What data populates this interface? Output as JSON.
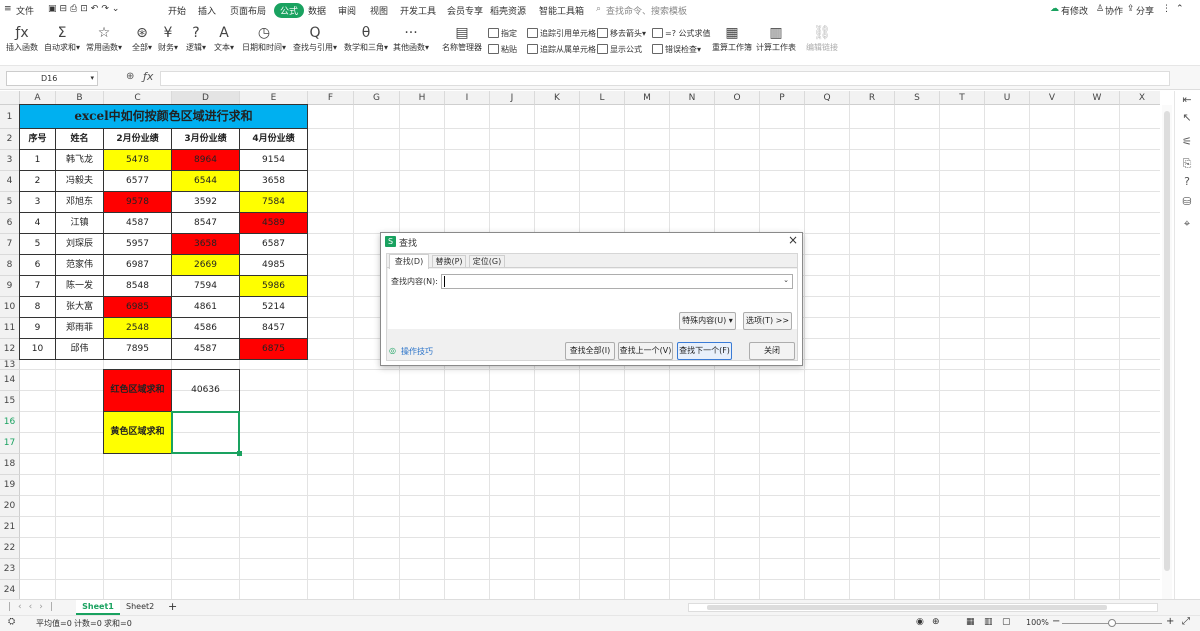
{
  "menu": {
    "file": "文件",
    "tabs": [
      "开始",
      "插入",
      "页面布局",
      "公式",
      "数据",
      "审阅",
      "视图",
      "开发工具",
      "会员专享",
      "稻壳资源",
      "智能工具箱"
    ],
    "active_tab": "公式",
    "search_placeholder": "查找命令、搜索模板",
    "right": [
      "有修改",
      "协作",
      "分享"
    ]
  },
  "ribbon": {
    "big": [
      {
        "icon": "ƒx",
        "label": "插入函数"
      },
      {
        "icon": "Σ",
        "label": "自动求和▾"
      },
      {
        "icon": "☆",
        "label": "常用函数▾"
      },
      {
        "icon": "⊛",
        "label": "全部▾"
      },
      {
        "icon": "¥",
        "label": "财务▾"
      },
      {
        "icon": "?",
        "label": "逻辑▾"
      },
      {
        "icon": "A",
        "label": "文本▾"
      },
      {
        "icon": "◷",
        "label": "日期和时间▾"
      },
      {
        "icon": "Q",
        "label": "查找与引用▾"
      },
      {
        "icon": "θ",
        "label": "数学和三角▾"
      },
      {
        "icon": "···",
        "label": "其他函数▾"
      },
      {
        "icon": "▤",
        "label": "名称管理器"
      }
    ],
    "small": [
      "指定",
      "粘贴",
      "追踪引用单元格",
      "追踪从属单元格",
      "移去箭头▾",
      "显示公式",
      "=? 公式求值",
      "错误检查▾"
    ],
    "big2": [
      {
        "icon": "▦",
        "label": "重算工作簿"
      },
      {
        "icon": "▥",
        "label": "计算工作表"
      },
      {
        "icon": "⛓",
        "label": "编辑链接"
      }
    ]
  },
  "formula_bar": {
    "name_box": "D16",
    "fx": "ƒx"
  },
  "columns": [
    "A",
    "B",
    "C",
    "D",
    "E",
    "F",
    "G",
    "H",
    "I",
    "J",
    "K",
    "L",
    "M",
    "N",
    "O",
    "P",
    "Q",
    "R",
    "S",
    "T",
    "U",
    "V",
    "W",
    "X"
  ],
  "rows": [
    "1",
    "2",
    "3",
    "4",
    "5",
    "6",
    "7",
    "8",
    "9",
    "10",
    "11",
    "12",
    "13",
    "14",
    "15",
    "16",
    "17",
    "18",
    "19",
    "20",
    "21",
    "22",
    "23",
    "24"
  ],
  "sheet": {
    "title": "excel中如何按颜色区域进行求和",
    "headers": [
      "序号",
      "姓名",
      "2月份业绩",
      "3月份业绩",
      "4月份业绩"
    ],
    "rows": [
      {
        "n": "1",
        "name": "韩飞龙",
        "feb": "5478",
        "mar": "8964",
        "apr": "9154"
      },
      {
        "n": "2",
        "name": "冯毅夫",
        "feb": "6577",
        "mar": "6544",
        "apr": "3658"
      },
      {
        "n": "3",
        "name": "邓旭东",
        "feb": "9578",
        "mar": "3592",
        "apr": "7584"
      },
      {
        "n": "4",
        "name": "江镇",
        "feb": "4587",
        "mar": "8547",
        "apr": "4589"
      },
      {
        "n": "5",
        "name": "刘琛辰",
        "feb": "5957",
        "mar": "3658",
        "apr": "6587"
      },
      {
        "n": "6",
        "name": "范家伟",
        "feb": "6987",
        "mar": "2669",
        "apr": "4985"
      },
      {
        "n": "7",
        "name": "陈一发",
        "feb": "8548",
        "mar": "7594",
        "apr": "5986"
      },
      {
        "n": "8",
        "name": "张大富",
        "feb": "6985",
        "mar": "4861",
        "apr": "5214"
      },
      {
        "n": "9",
        "name": "郑雨菲",
        "feb": "2548",
        "mar": "4586",
        "apr": "8457"
      },
      {
        "n": "10",
        "name": "邱伟",
        "feb": "7895",
        "mar": "4587",
        "apr": "6875"
      }
    ],
    "colors": [
      [
        "",
        "y",
        "r",
        ""
      ],
      [
        "",
        "",
        "y",
        ""
      ],
      [
        "",
        "r",
        "",
        "y"
      ],
      [
        "",
        "",
        "",
        "r"
      ],
      [
        "",
        "",
        "r",
        ""
      ],
      [
        "",
        "",
        "y",
        ""
      ],
      [
        "",
        "",
        "",
        "y"
      ],
      [
        "",
        "r",
        "",
        ""
      ],
      [
        "",
        "y",
        "",
        ""
      ],
      [
        "",
        "",
        "",
        "r"
      ]
    ],
    "red_label": "红色区域求和",
    "red_value": "40636",
    "yellow_label": "黄色区域求和",
    "yellow_value": ""
  },
  "dialog": {
    "title": "查找",
    "tabs": [
      "查找(D)",
      "替换(P)",
      "定位(G)"
    ],
    "field_label": "查找内容(N):",
    "field_value": "",
    "special": "特殊内容(U) ▾",
    "options": "选项(T) >>",
    "tips": "操作技巧",
    "find_all": "查找全部(I)",
    "find_prev": "查找上一个(V)",
    "find_next": "查找下一个(F)",
    "close": "关闭"
  },
  "tabs": {
    "sheets": [
      "Sheet1",
      "Sheet2"
    ],
    "active": "Sheet1",
    "add": "+"
  },
  "status": {
    "avg": "平均值=0",
    "count": "计数=0",
    "sum": "求和=0",
    "zoom": "100%"
  },
  "colors": {
    "green": "#1aa260",
    "red": "#ff0000",
    "yellow": "#ffff00",
    "blue": "#00b0f0"
  }
}
